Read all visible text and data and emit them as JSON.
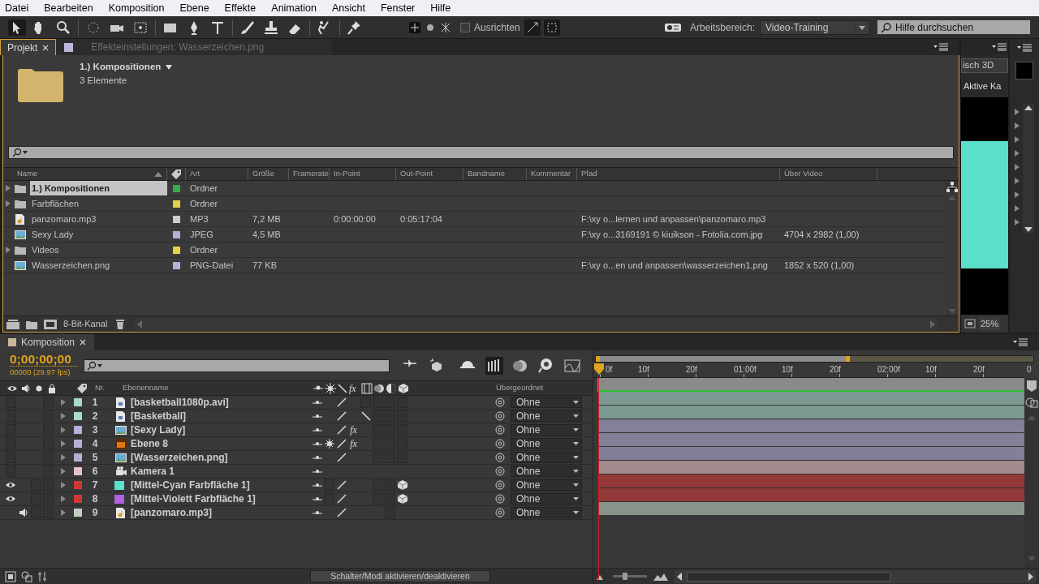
{
  "menu": [
    "Datei",
    "Bearbeiten",
    "Komposition",
    "Ebene",
    "Effekte",
    "Animation",
    "Ansicht",
    "Fenster",
    "Hilfe"
  ],
  "toolbar": {
    "snap": {
      "label": "Ausrichten",
      "checked": false
    },
    "workspace_label": "Arbeitsbereich:",
    "workspace": "Video-Training",
    "help_search": {
      "placeholder": "Hilfe durchsuchen"
    }
  },
  "project": {
    "tabs": [
      {
        "label": "Projekt",
        "selected": true
      },
      {
        "label": "Effekteinstellungen: Wasserzeichen.png",
        "selected": false
      }
    ],
    "folder": {
      "name": "1.) Kompositionen",
      "count": "3 Elemente"
    },
    "columns": [
      "Name",
      "Art",
      "Größe",
      "Framerate",
      "In-Point",
      "Out-Point",
      "Bandname",
      "Kommentar",
      "Pfad",
      "Über Video"
    ],
    "rows": [
      {
        "kind": "folder",
        "name": "1.) Kompositionen",
        "selected": true,
        "color": "#3caa4a",
        "type": "Ordner"
      },
      {
        "kind": "folder",
        "name": "Farbflächen",
        "selected": false,
        "color": "#e8d048",
        "type": "Ordner"
      },
      {
        "kind": "audio",
        "name": "panzomaro.mp3",
        "selected": false,
        "color": "#c8d0c8",
        "type": "MP3",
        "size": "7,2 MB",
        "in": "0:00:00:00",
        "out": "0:05:17:04",
        "path": "F:\\xy o...lernen und anpassen\\panzomaro.mp3"
      },
      {
        "kind": "image",
        "name": "Sexy Lady",
        "selected": false,
        "color": "#b4b0d8",
        "type": "JPEG",
        "size": "4,5 MB",
        "path": "F:\\xy o...3169191 © kiuikson - Fotolia.com.jpg",
        "video": "4704 x 2982 (1,00)"
      },
      {
        "kind": "folder",
        "name": "Videos",
        "selected": false,
        "color": "#e8d048",
        "type": "Ordner"
      },
      {
        "kind": "image",
        "name": "Wasserzeichen.png",
        "selected": false,
        "color": "#b4b0d8",
        "type": "PNG-Datei",
        "size": "77 KB",
        "path": "F:\\xy o...en und anpassen\\wasserzeichen1.png",
        "video": "1852 x 520 (1,00)"
      }
    ],
    "footer": "8-Bit-Kanal"
  },
  "viewer": {
    "button": "isch 3D",
    "camera": "Aktive Ka",
    "zoom": "25%"
  },
  "timeline": {
    "tab": "Komposition",
    "timecode": "0;00;00;00",
    "frames": "00000 (29.97 fps)",
    "columns": {
      "number": "Nr.",
      "name": "Ebenenname",
      "fx": "fx",
      "parent": "Übergeordnet"
    },
    "ruler": [
      "0f",
      "10f",
      "20f",
      "01:00f",
      "10f",
      "20f",
      "02:00f",
      "10f",
      "20f",
      "0"
    ],
    "zoom_slider": {
      "level": 0.35
    },
    "layers": [
      {
        "nr": "1",
        "name": "[basketball1080p.avi]",
        "kind": "video",
        "color": "#a8d8cc",
        "av": [
          {
            "kind": "box"
          },
          {
            "kind": "empty"
          },
          {
            "kind": "empty"
          },
          {
            "kind": "box"
          }
        ],
        "switches": [
          {
            "kind": "icon"
          },
          {
            "kind": "empty"
          },
          {
            "kind": "icon"
          },
          {
            "kind": "empty"
          },
          {
            "kind": "box"
          },
          {
            "kind": "box"
          },
          {
            "kind": "box"
          },
          {
            "kind": "box"
          }
        ],
        "parent": "Ohne"
      },
      {
        "nr": "2",
        "name": "[Basketball]",
        "kind": "video",
        "color": "#a8d8cc",
        "av": [
          {
            "kind": "box"
          },
          {
            "kind": "empty"
          },
          {
            "kind": "empty"
          },
          {
            "kind": "box"
          }
        ],
        "switches": [
          {
            "kind": "icon"
          },
          {
            "kind": "empty"
          },
          {
            "kind": "icon"
          },
          {
            "kind": "empty"
          },
          {
            "kind": "icon"
          },
          {
            "kind": "box"
          },
          {
            "kind": "box"
          },
          {
            "kind": "box"
          }
        ],
        "parent": "Ohne"
      },
      {
        "nr": "3",
        "name": "[Sexy Lady]",
        "kind": "image",
        "color": "#b4b0d8",
        "av": [
          {
            "kind": "box"
          },
          {
            "kind": "empty"
          },
          {
            "kind": "empty"
          },
          {
            "kind": "box"
          }
        ],
        "switches": [
          {
            "kind": "icon"
          },
          {
            "kind": "empty"
          },
          {
            "kind": "icon"
          },
          {
            "kind": "icon"
          },
          {
            "kind": "empty"
          },
          {
            "kind": "box"
          },
          {
            "kind": "box"
          },
          {
            "kind": "box"
          }
        ],
        "effects": "fx",
        "parent": "Ohne"
      },
      {
        "nr": "4",
        "name": "Ebene 8",
        "kind": "vector",
        "color": "#b4b0d8",
        "av": [
          {
            "kind": "box"
          },
          {
            "kind": "empty"
          },
          {
            "kind": "empty"
          },
          {
            "kind": "box"
          }
        ],
        "switches": [
          {
            "kind": "icon"
          },
          {
            "kind": "icon"
          },
          {
            "kind": "icon"
          },
          {
            "kind": "icon"
          },
          {
            "kind": "empty"
          },
          {
            "kind": "box"
          },
          {
            "kind": "box"
          },
          {
            "kind": "box"
          }
        ],
        "effects": "fx",
        "parent": "Ohne"
      },
      {
        "nr": "5",
        "name": "[Wasserzeichen.png]",
        "kind": "image",
        "color": "#b4b0d8",
        "av": [
          {
            "kind": "box"
          },
          {
            "kind": "empty"
          },
          {
            "kind": "empty"
          },
          {
            "kind": "box"
          }
        ],
        "switches": [
          {
            "kind": "icon"
          },
          {
            "kind": "empty"
          },
          {
            "kind": "icon"
          },
          {
            "kind": "empty"
          },
          {
            "kind": "empty"
          },
          {
            "kind": "box"
          },
          {
            "kind": "box"
          },
          {
            "kind": "box"
          }
        ],
        "parent": "Ohne"
      },
      {
        "nr": "6",
        "name": "Kamera 1",
        "kind": "camera",
        "color": "#e8c0c8",
        "av": [
          {
            "kind": "box"
          },
          {
            "kind": "empty"
          },
          {
            "kind": "empty"
          },
          {
            "kind": "box"
          }
        ],
        "switches": [
          {
            "kind": "icon"
          },
          {
            "kind": "empty"
          },
          {
            "kind": "empty"
          },
          {
            "kind": "empty"
          },
          {
            "kind": "empty"
          },
          {
            "kind": "empty"
          },
          {
            "kind": "empty"
          },
          {
            "kind": "empty"
          }
        ],
        "parent": "Ohne"
      },
      {
        "nr": "7",
        "name": "[Mittel-Cyan Farbfläche 1]",
        "kind": "solid",
        "solid": {
          "color": "#5ee0cc"
        },
        "color": "#d03838",
        "av": [
          {
            "kind": "icon"
          },
          {
            "kind": "empty"
          },
          {
            "kind": "box"
          },
          {
            "kind": "box"
          }
        ],
        "switches": [
          {
            "kind": "icon"
          },
          {
            "kind": "box"
          },
          {
            "kind": "icon"
          },
          {
            "kind": "empty"
          },
          {
            "kind": "empty"
          },
          {
            "kind": "box"
          },
          {
            "kind": "box"
          },
          {
            "kind": "icon"
          }
        ],
        "parent": "Ohne"
      },
      {
        "nr": "8",
        "name": "[Mittel-Violett Farbfläche 1]",
        "kind": "solid",
        "solid": {
          "color": "#b060e0"
        },
        "color": "#d03838",
        "av": [
          {
            "kind": "icon"
          },
          {
            "kind": "empty"
          },
          {
            "kind": "box"
          },
          {
            "kind": "box"
          }
        ],
        "switches": [
          {
            "kind": "icon"
          },
          {
            "kind": "box"
          },
          {
            "kind": "icon"
          },
          {
            "kind": "empty"
          },
          {
            "kind": "empty"
          },
          {
            "kind": "box"
          },
          {
            "kind": "box"
          },
          {
            "kind": "icon"
          }
        ],
        "parent": "Ohne"
      },
      {
        "nr": "9",
        "name": "[panzomaro.mp3]",
        "kind": "audio",
        "color": "#c0d0c0",
        "av": [
          {
            "kind": "empty"
          },
          {
            "kind": "icon"
          },
          {
            "kind": "box"
          },
          {
            "kind": "box"
          }
        ],
        "switches": [
          {
            "kind": "icon"
          },
          {
            "kind": "empty"
          },
          {
            "kind": "icon"
          },
          {
            "kind": "empty"
          },
          {
            "kind": "empty"
          },
          {
            "kind": "empty"
          },
          {
            "kind": "box"
          },
          {
            "kind": "empty"
          }
        ],
        "parent": "Ohne"
      }
    ],
    "toggle_button": "Schalter/Modi aktivieren/deaktivieren"
  }
}
